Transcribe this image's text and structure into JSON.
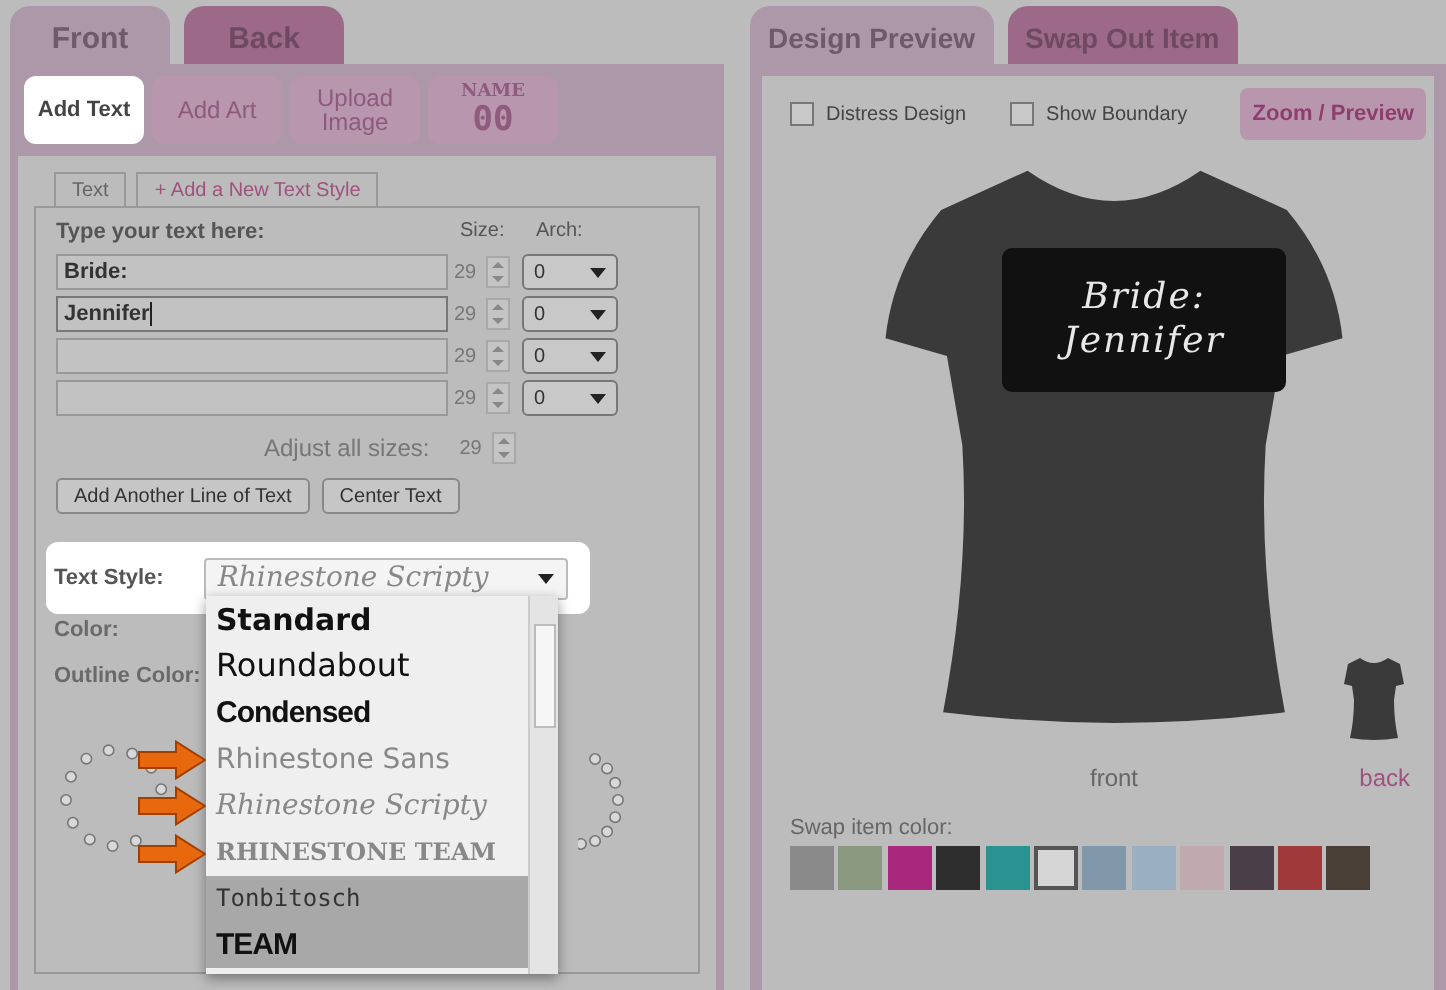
{
  "left_tabs": [
    {
      "label": "Front",
      "selected": true
    },
    {
      "label": "Back",
      "selected": false
    }
  ],
  "tools": [
    {
      "kind": "text",
      "label": "Add Text",
      "selected": true
    },
    {
      "kind": "text",
      "label": "Add Art",
      "selected": false
    },
    {
      "kind": "text",
      "label": "Upload Image",
      "selected": false
    },
    {
      "kind": "jersey",
      "label": "NAME",
      "number": "00",
      "selected": false
    }
  ],
  "sub_tabs": [
    {
      "label": "Text",
      "selected": true
    },
    {
      "label": "+ Add a New Text Style",
      "selected": false
    }
  ],
  "text_editor": {
    "heading": "Type your text here:",
    "size_label": "Size:",
    "arch_label": "Arch:",
    "lines": [
      {
        "value": "Bride:",
        "size": "29",
        "arch": "0",
        "focused": false
      },
      {
        "value": "Jennifer",
        "size": "29",
        "arch": "0",
        "focused": true
      },
      {
        "size": "29",
        "arch": "0",
        "focused": false
      },
      {
        "size": "29",
        "arch": "0",
        "focused": false
      }
    ],
    "adjust_label": "Adjust all sizes:",
    "adjust_size": "29",
    "buttons": [
      "Add Another Line of Text",
      "Center Text"
    ]
  },
  "style_options": {
    "text_style_label": "Text Style:",
    "text_style_value": "Rhinestone Scripty",
    "color_label": "Color:",
    "outline_label": "Outline Color:",
    "dropdown": [
      {
        "label": "Standard",
        "kind": "bold",
        "arrow": false,
        "highlighted": true
      },
      {
        "label": "Roundabout",
        "kind": "round",
        "arrow": false,
        "highlighted": true
      },
      {
        "label": "Condensed",
        "kind": "condensed",
        "arrow": false,
        "highlighted": true
      },
      {
        "label": "Rhinestone Sans",
        "kind": "light",
        "arrow": true,
        "highlighted": true
      },
      {
        "label": "Rhinestone Scripty",
        "kind": "script",
        "arrow": true,
        "highlighted": true
      },
      {
        "label": "RHINESTONE TEAM",
        "kind": "team",
        "arrow": true,
        "highlighted": true
      },
      {
        "label": "Tonbitosch",
        "kind": "hand",
        "arrow": false,
        "highlighted": false
      },
      {
        "label": "TEAM",
        "kind": "condensed",
        "arrow": false,
        "highlighted": false
      }
    ]
  },
  "right_tabs": [
    {
      "label": "Design Preview",
      "selected": true
    },
    {
      "label": "Swap Out Item",
      "selected": false
    }
  ],
  "preview": {
    "options": [
      {
        "label": "Distress Design",
        "checked": false
      },
      {
        "label": "Show Boundary",
        "checked": false
      }
    ],
    "zoom_button": "Zoom / Preview",
    "design_lines": [
      "Bride:",
      "Jennifer"
    ],
    "views": [
      {
        "label": "front",
        "selected": true
      },
      {
        "label": "back",
        "selected": false
      }
    ],
    "swap_label": "Swap item color:",
    "swatches": [
      {
        "color": "#8a8a8a",
        "selected": false
      },
      {
        "color": "#8a9880",
        "selected": false
      },
      {
        "color": "#a8287e",
        "selected": false
      },
      {
        "color": "#2e2e2e",
        "selected": false
      },
      {
        "color": "#2a9290",
        "selected": false
      },
      {
        "color": "#d6d6d6",
        "selected": true
      },
      {
        "color": "#8098aa",
        "selected": false
      },
      {
        "color": "#9ab0c0",
        "selected": false
      },
      {
        "color": "#c0aab0",
        "selected": false
      },
      {
        "color": "#4a3e48",
        "selected": false
      },
      {
        "color": "#a03a3a",
        "selected": false
      },
      {
        "color": "#4a4038",
        "selected": false
      }
    ]
  }
}
